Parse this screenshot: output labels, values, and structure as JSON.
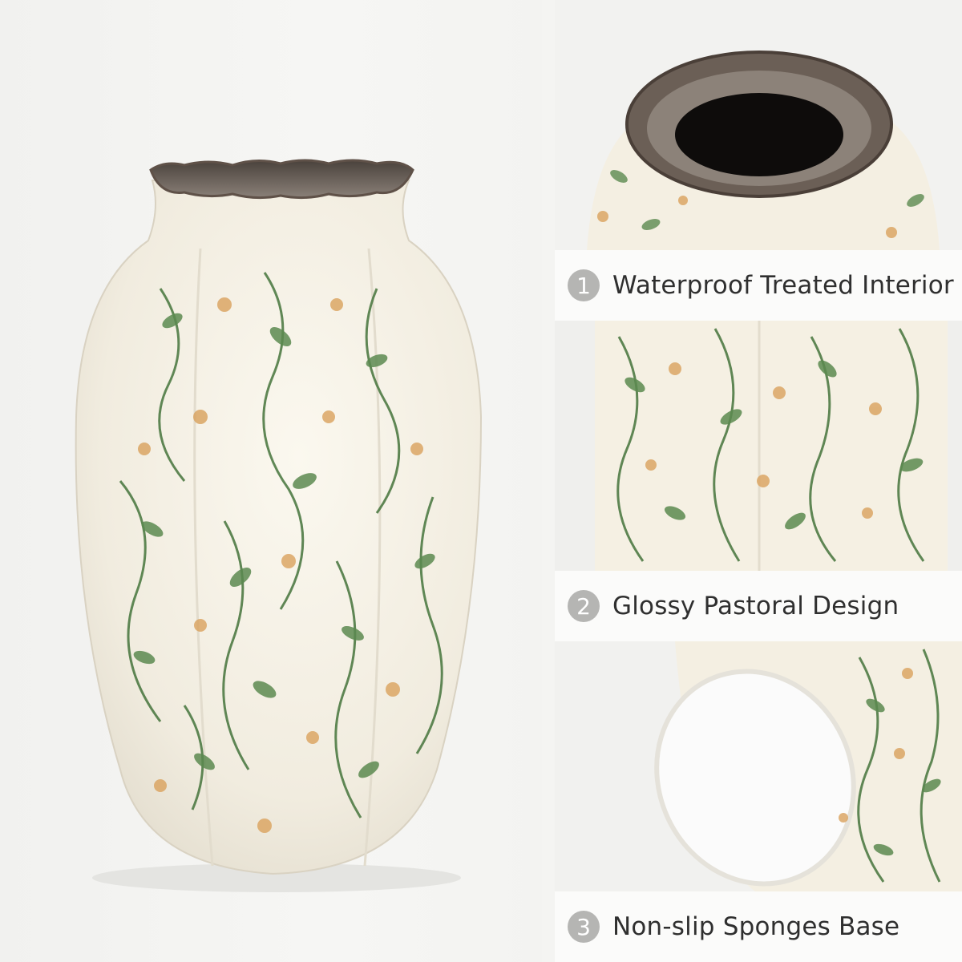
{
  "features": [
    {
      "number": "1",
      "label": "Waterproof Treated Interior"
    },
    {
      "number": "2",
      "label": "Glossy Pastoral Design"
    },
    {
      "number": "3",
      "label": "Non-slip Sponges Base"
    }
  ],
  "colors": {
    "background": "#f4f4f2",
    "caption_background": "#fbfbfa",
    "number_badge": "#b5b5b3",
    "caption_text": "#2f2f2f",
    "vase_glaze": "#f3efe3",
    "leaf_green": "#4f7b45",
    "flower_ochre": "#d9a15c",
    "rim_brown": "#5f5148"
  }
}
